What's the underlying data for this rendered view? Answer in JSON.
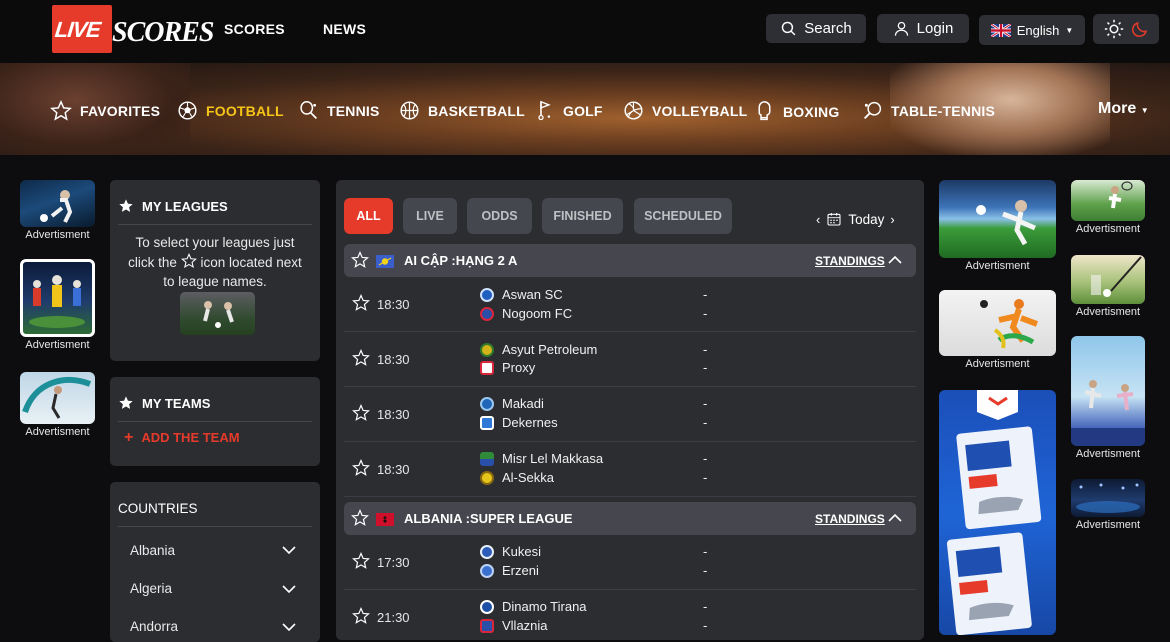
{
  "header": {
    "logo_live": "LIVE",
    "logo_scores": "SCORES",
    "nav": [
      "SCORES",
      "NEWS"
    ],
    "search_label": "Search",
    "login_label": "Login",
    "language": "English",
    "accent": "#e63a2b"
  },
  "sports": {
    "items": [
      "FAVORITES",
      "FOOTBALL",
      "TENNIS",
      "BASKETBALL",
      "GOLF",
      "VOLLEYBALL",
      "BOXING",
      "TABLE-TENNIS"
    ],
    "active": "FOOTBALL",
    "more": "More"
  },
  "ads": {
    "label": "Advertisment"
  },
  "my_leagues": {
    "title": "MY LEAGUES",
    "hint_part1": "To select your leagues just click the",
    "hint_part2": "icon located next to league names."
  },
  "my_teams": {
    "title": "MY TEAMS",
    "add_label": "ADD THE TEAM"
  },
  "countries": {
    "title": "COUNTRIES",
    "items": [
      "Albania",
      "Algeria",
      "Andorra"
    ]
  },
  "filters": {
    "tabs": [
      "ALL",
      "LIVE",
      "ODDS",
      "FINISHED",
      "SCHEDULED"
    ],
    "active": "ALL",
    "date_label": "Today"
  },
  "leagues": [
    {
      "name": "AI CẬP :HẠNG 2 A",
      "standings": "STANDINGS",
      "matches": [
        {
          "time": "18:30",
          "home": "Aswan SC",
          "away": "Nogoom FC",
          "home_score": "-",
          "away_score": "-"
        },
        {
          "time": "18:30",
          "home": "Asyut Petroleum",
          "away": "Proxy",
          "home_score": "-",
          "away_score": "-"
        },
        {
          "time": "18:30",
          "home": "Makadi",
          "away": "Dekernes",
          "home_score": "-",
          "away_score": "-"
        },
        {
          "time": "18:30",
          "home": "Misr Lel Makkasa",
          "away": "Al-Sekka",
          "home_score": "-",
          "away_score": "-"
        }
      ]
    },
    {
      "name": "ALBANIA :SUPER LEAGUE",
      "standings": "STANDINGS",
      "matches": [
        {
          "time": "17:30",
          "home": "Kukesi",
          "away": "Erzeni",
          "home_score": "-",
          "away_score": "-"
        },
        {
          "time": "21:30",
          "home": "Dinamo Tirana",
          "away": "Vllaznia",
          "home_score": "-",
          "away_score": "-"
        }
      ]
    }
  ]
}
